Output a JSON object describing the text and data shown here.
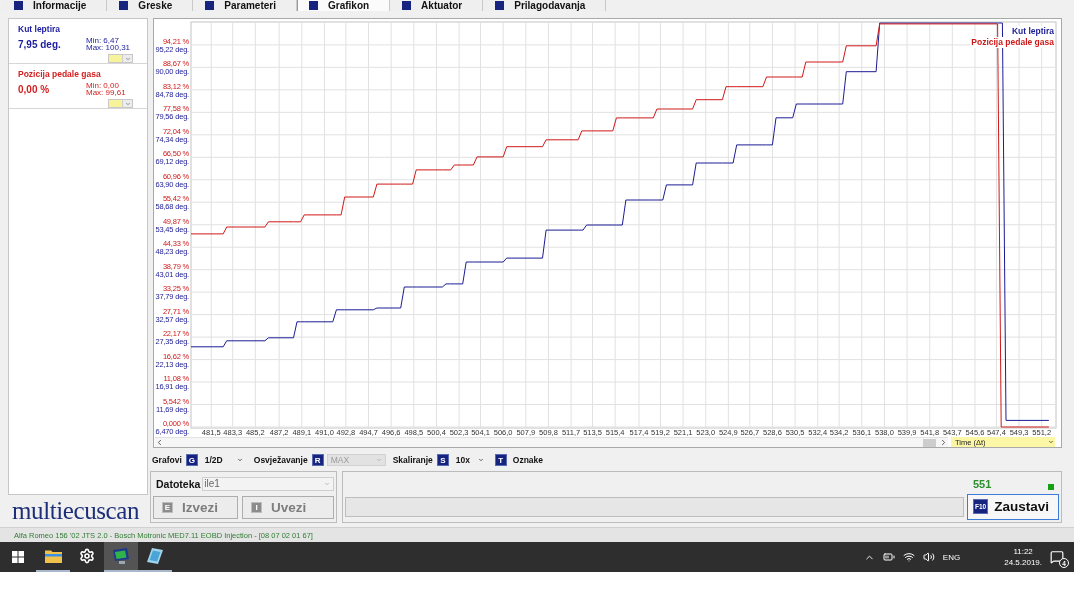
{
  "tabs": [
    {
      "label": "Informacije",
      "selected": false
    },
    {
      "label": "Greske",
      "selected": false
    },
    {
      "label": "Parameteri",
      "selected": false
    },
    {
      "label": "Grafikon",
      "selected": true
    },
    {
      "label": "Aktuator",
      "selected": false
    },
    {
      "label": "Prilagodavanja",
      "selected": false
    }
  ],
  "parameters": [
    {
      "name": "Kut leptira",
      "value": "7,95 deg.",
      "min": "Min: 6,47",
      "max": "Max: 100,31",
      "color": "#1c1ca0"
    },
    {
      "name": "Pozicija pedale gasa",
      "value": "0,00 %",
      "min": "Min: 0,00",
      "max": "Max: 99,61",
      "color": "#d42020"
    }
  ],
  "logo": "multiecuscan",
  "chart": {
    "chart_data": {
      "type": "line",
      "grid": true,
      "x": [
        479.8,
        482.5,
        482.8,
        486.0,
        486.3,
        488.4,
        488.7,
        489.0,
        489.3,
        491.7,
        492.0,
        492.4,
        492.7,
        495.1,
        495.4,
        497.4,
        497.7,
        498.4,
        498.7,
        500.9,
        501.2,
        501.6,
        501.9,
        502.6,
        502.9,
        503.5,
        503.8,
        506.0,
        506.3,
        509.3,
        509.6,
        512.3,
        512.6,
        512.7,
        513.0,
        515.2,
        515.5,
        516.0,
        516.3,
        518.6,
        518.9,
        519.4,
        519.7,
        521.9,
        522.2,
        524.4,
        524.7,
        525.3,
        525.6,
        527.8,
        528.1,
        528.6,
        528.9,
        530.3,
        530.6,
        531.1,
        531.4,
        534.5,
        534.8,
        537.3,
        537.6,
        547.5,
        547.8,
        547.9,
        548.2,
        551.8
      ],
      "xlim": [
        479.8,
        552.4
      ],
      "ylim": [
        0.0,
        99.61
      ],
      "y2lim": [
        6.47,
        100.31
      ],
      "xticks": [
        {
          "value": 481.5,
          "label": "481,5"
        },
        {
          "value": 483.3,
          "label": "483,3"
        },
        {
          "value": 485.2,
          "label": "485,2"
        },
        {
          "value": 487.2,
          "label": "487,2"
        },
        {
          "value": 489.1,
          "label": "489,1"
        },
        {
          "value": 491.0,
          "label": "491,0"
        },
        {
          "value": 492.8,
          "label": "492,8"
        },
        {
          "value": 494.7,
          "label": "494,7"
        },
        {
          "value": 496.6,
          "label": "496,6"
        },
        {
          "value": 498.5,
          "label": "498,5"
        },
        {
          "value": 500.4,
          "label": "500,4"
        },
        {
          "value": 502.3,
          "label": "502,3"
        },
        {
          "value": 504.1,
          "label": "504,1"
        },
        {
          "value": 506.0,
          "label": "506,0"
        },
        {
          "value": 507.9,
          "label": "507,9"
        },
        {
          "value": 509.8,
          "label": "509,8"
        },
        {
          "value": 511.7,
          "label": "511,7"
        },
        {
          "value": 513.5,
          "label": "513,5"
        },
        {
          "value": 515.4,
          "label": "515,4"
        },
        {
          "value": 517.4,
          "label": "517,4"
        },
        {
          "value": 519.2,
          "label": "519,2"
        },
        {
          "value": 521.1,
          "label": "521,1"
        },
        {
          "value": 523.0,
          "label": "523,0"
        },
        {
          "value": 524.9,
          "label": "524,9"
        },
        {
          "value": 526.7,
          "label": "526,7"
        },
        {
          "value": 528.6,
          "label": "528,6"
        },
        {
          "value": 530.5,
          "label": "530,5"
        },
        {
          "value": 532.4,
          "label": "532,4"
        },
        {
          "value": 534.2,
          "label": "534,2"
        },
        {
          "value": 536.1,
          "label": "536,1"
        },
        {
          "value": 538.0,
          "label": "538,0"
        },
        {
          "value": 539.9,
          "label": "539,9"
        },
        {
          "value": 541.8,
          "label": "541,8"
        },
        {
          "value": 543.7,
          "label": "543,7"
        },
        {
          "value": 545.6,
          "label": "545,6"
        },
        {
          "value": 547.4,
          "label": "547,4"
        },
        {
          "value": 549.3,
          "label": "549,3"
        },
        {
          "value": 551.2,
          "label": "551,2"
        }
      ],
      "yticks": [
        {
          "value": 94.21,
          "label": "94,21 %"
        },
        {
          "value": 88.67,
          "label": "88,67 %"
        },
        {
          "value": 83.12,
          "label": "83,12 %"
        },
        {
          "value": 77.58,
          "label": "77,58 %"
        },
        {
          "value": 72.04,
          "label": "72,04 %"
        },
        {
          "value": 66.5,
          "label": "66,50 %"
        },
        {
          "value": 60.96,
          "label": "60,96 %"
        },
        {
          "value": 55.42,
          "label": "55,42 %"
        },
        {
          "value": 49.87,
          "label": "49,87 %"
        },
        {
          "value": 44.33,
          "label": "44,33 %"
        },
        {
          "value": 38.79,
          "label": "38,79 %"
        },
        {
          "value": 33.25,
          "label": "33,25 %"
        },
        {
          "value": 27.71,
          "label": "27,71 %"
        },
        {
          "value": 22.17,
          "label": "22,17 %"
        },
        {
          "value": 16.62,
          "label": "16,62 %"
        },
        {
          "value": 11.08,
          "label": "11,08 %"
        },
        {
          "value": 5.542,
          "label": "5,542 %"
        },
        {
          "value": 0.0,
          "label": "0,000 %"
        }
      ],
      "y2ticks": [
        {
          "value": 95.22,
          "label": "95,22 deg."
        },
        {
          "value": 90.0,
          "label": "90,00 deg."
        },
        {
          "value": 84.78,
          "label": "84,78 deg."
        },
        {
          "value": 79.56,
          "label": "79,56 deg."
        },
        {
          "value": 74.34,
          "label": "74,34 deg."
        },
        {
          "value": 69.12,
          "label": "69,12 deg."
        },
        {
          "value": 63.9,
          "label": "63,90 deg."
        },
        {
          "value": 58.68,
          "label": "58,68 deg."
        },
        {
          "value": 53.45,
          "label": "53,45 deg."
        },
        {
          "value": 48.23,
          "label": "48,23 deg."
        },
        {
          "value": 43.01,
          "label": "43,01 deg."
        },
        {
          "value": 37.79,
          "label": "37,79 deg."
        },
        {
          "value": 32.57,
          "label": "32,57 deg."
        },
        {
          "value": 27.35,
          "label": "27,35 deg."
        },
        {
          "value": 22.13,
          "label": "22,13 deg."
        },
        {
          "value": 16.91,
          "label": "16,91 deg."
        },
        {
          "value": 11.69,
          "label": "11,69 deg."
        },
        {
          "value": 6.47,
          "label": "6,470 deg."
        }
      ],
      "series": [
        {
          "name": "Kut leptira",
          "color": "#1c1c96",
          "axis": "y2",
          "values": [
            25.1,
            25.1,
            26.5,
            26.5,
            27.2,
            27.2,
            30.9,
            30.9,
            30.9,
            30.9,
            33.7,
            33.7,
            33.7,
            33.7,
            34.1,
            34.1,
            39.0,
            39.0,
            39.0,
            39.0,
            39.7,
            39.7,
            39.7,
            39.7,
            44.8,
            44.8,
            44.8,
            44.8,
            45.7,
            45.7,
            52.2,
            52.2,
            52.2,
            52.2,
            53.4,
            53.4,
            53.4,
            53.4,
            59.2,
            59.2,
            59.2,
            59.2,
            62.7,
            62.7,
            67.8,
            67.8,
            67.8,
            67.8,
            72.0,
            72.0,
            72.0,
            72.0,
            78.3,
            78.3,
            81.5,
            81.5,
            81.5,
            81.5,
            89.0,
            89.0,
            100.3,
            100.3,
            100.3,
            100.3,
            8.0,
            8.0
          ]
        },
        {
          "name": "Pozicija pedale gasa",
          "color": "#d01818",
          "axis": "y",
          "values": [
            47.6,
            47.6,
            49.3,
            49.3,
            50.6,
            50.6,
            50.6,
            50.6,
            52.3,
            52.3,
            52.3,
            52.3,
            56.7,
            56.7,
            59.9,
            59.9,
            59.9,
            59.9,
            63.4,
            63.4,
            63.4,
            63.4,
            64.6,
            64.6,
            64.6,
            64.6,
            66.6,
            66.6,
            69.1,
            69.1,
            70.8,
            70.8,
            73.0,
            73.0,
            73.0,
            73.0,
            76.2,
            76.2,
            76.2,
            76.2,
            78.4,
            78.4,
            78.4,
            78.4,
            80.7,
            80.7,
            83.9,
            83.9,
            83.9,
            83.9,
            86.3,
            86.3,
            86.3,
            86.3,
            86.3,
            86.3,
            90.0,
            90.0,
            94.0,
            94.0,
            99.4,
            99.4,
            0.0,
            0.0,
            0.0,
            0.0
          ]
        }
      ]
    },
    "x_axis": "Time (Δt)"
  },
  "controls": [
    {
      "kind": "select",
      "label": "Grafovi",
      "key": "G",
      "value": "1/2D",
      "disabled": false
    },
    {
      "kind": "select",
      "label": "Osvježavanje",
      "key": "R",
      "value": "MAX",
      "disabled": true
    },
    {
      "kind": "select",
      "label": "Skaliranje",
      "key": "S",
      "value": "10x",
      "disabled": false
    },
    {
      "kind": "button",
      "label": "Oznake",
      "key": "T",
      "disabled": false
    }
  ],
  "file_panel": {
    "label": "Datoteka",
    "file": {
      "value": "ile1",
      "disabled": true
    },
    "buttons": [
      {
        "key": "E",
        "label": "Izvezi",
        "disabled": true
      },
      {
        "key": "I",
        "label": "Uvezi",
        "disabled": true
      }
    ]
  },
  "recording": {
    "count": "551",
    "progress": {
      "level": 0
    },
    "stop_button": {
      "key": "F10",
      "label": "Zaustavi"
    }
  },
  "status_bar": "Alfa Romeo 156 '02 JTS 2.0 - Bosch Motronic MED7.11 EOBD Injection - [08 07 02 01 67]",
  "taskbar": {
    "apps": [
      {
        "kind": "explorer",
        "open": true,
        "active": false
      },
      {
        "kind": "settings",
        "open": false,
        "active": false
      },
      {
        "kind": "diagnostics",
        "open": true,
        "active": true
      },
      {
        "kind": "notes",
        "open": true,
        "active": false
      }
    ],
    "language": "ENG",
    "time": "11:22",
    "date": "24.5.2019.",
    "notification_count": "4"
  }
}
